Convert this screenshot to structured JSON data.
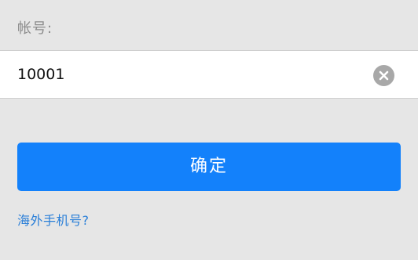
{
  "form": {
    "account_label": "帐号:",
    "account_value": "10001",
    "clear_icon": "clear-circle-icon",
    "confirm_label": "确定",
    "overseas_link": "海外手机号?"
  },
  "colors": {
    "background": "#e6e6e6",
    "input_background": "#ffffff",
    "label_gray": "#8c8c8c",
    "clear_icon_gray": "#a8a8a8",
    "primary_blue": "#1381fb",
    "link_blue": "#2a7fd8"
  }
}
